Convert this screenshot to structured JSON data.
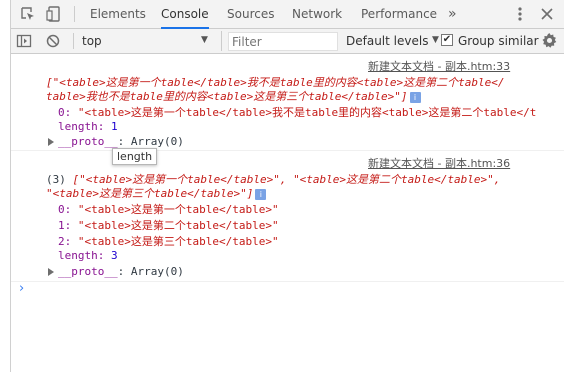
{
  "tabs": [
    "Elements",
    "Console",
    "Sources",
    "Network",
    "Performance"
  ],
  "more_tabs_glyph": "»",
  "toolbar": {
    "context": "top",
    "filter_placeholder": "Filter",
    "levels": "Default levels",
    "levels_arrow": "▼",
    "group_similar": "Group similar"
  },
  "messages": [
    {
      "source": "新建文本文档 - 副本.htm:33",
      "summary_line1": "[\"<table>这是第一个table</table>我不是table里的内容<table>这是第二个table</",
      "summary_line2": "table>我也不是table里的内容<table>这是第三个table</table>\"]",
      "item0_key": "0:",
      "item0_value": "\"<table>这是第一个table</table>我不是table里的内容<table>这是第二个table</t",
      "length_key": "length:",
      "length_value": "1",
      "proto_key": "__proto__",
      "proto_value": ": Array(0)",
      "tooltip": "length"
    },
    {
      "source": "新建文本文档 - 副本.htm:36",
      "summary_count": "(3)",
      "summary_line1": "[\"<table>这是第一个table</table>\", \"<table>这是第二个table</table>\",",
      "summary_line2": "\"<table>这是第三个table</table>\"]",
      "items": [
        {
          "key": "0:",
          "value": "\"<table>这是第一个table</table>\""
        },
        {
          "key": "1:",
          "value": "\"<table>这是第二个table</table>\""
        },
        {
          "key": "2:",
          "value": "\"<table>这是第三个table</table>\""
        }
      ],
      "length_key": "length:",
      "length_value": "3",
      "proto_key": "__proto__",
      "proto_value": ": Array(0)"
    }
  ],
  "prompt_glyph": "›",
  "info_badge": "i",
  "colors": {
    "string": "#c41a16",
    "key": "#881391",
    "number": "#1c00cf",
    "accent": "#1a73e8",
    "prompt": "#367cf1"
  }
}
